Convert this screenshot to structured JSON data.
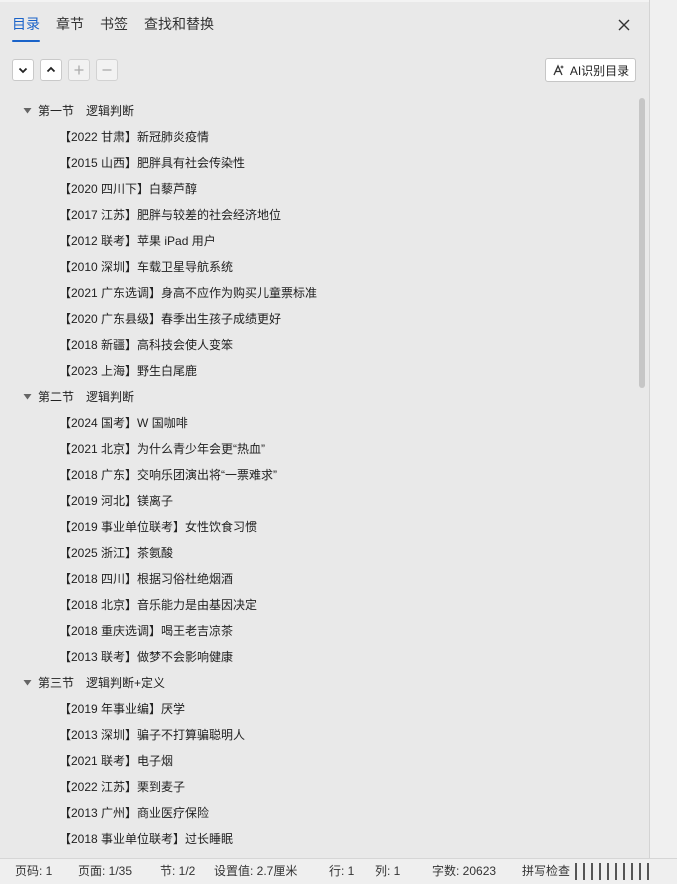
{
  "tabs": [
    "目录",
    "章节",
    "书签",
    "查找和替换"
  ],
  "active_tab": "目录",
  "toolbar": {
    "ai_button": "AI识别目录"
  },
  "toc": [
    {
      "title": "第一节　逻辑判断",
      "items": [
        "【2022 甘肃】新冠肺炎疫情",
        "【2015 山西】肥胖具有社会传染性",
        "【2020 四川下】白藜芦醇",
        "【2017 江苏】肥胖与较差的社会经济地位",
        "【2012 联考】苹果 iPad 用户",
        "【2010 深圳】车载卫星导航系统",
        "【2021 广东选调】身高不应作为购买儿童票标准",
        "【2020 广东县级】春季出生孩子成绩更好",
        "【2018 新疆】高科技会使人变笨",
        "【2023 上海】野生白尾鹿"
      ]
    },
    {
      "title": "第二节　逻辑判断",
      "items": [
        "【2024 国考】W 国咖啡",
        "【2021 北京】为什么青少年会更“热血”",
        "【2018 广东】交响乐团演出将“一票难求”",
        "【2019 河北】镁离子",
        "【2019 事业单位联考】女性饮食习惯",
        "【2025 浙江】茶氨酸",
        "【2018 四川】根据习俗杜绝烟酒",
        "【2018 北京】音乐能力是由基因决定",
        "【2018 重庆选调】喝王老吉凉茶",
        "【2013 联考】做梦不会影响健康"
      ]
    },
    {
      "title": "第三节　逻辑判断+定义",
      "items": [
        "【2019 年事业编】厌学",
        "【2013 深圳】骗子不打算骗聪明人",
        "【2021 联考】电子烟",
        "【2022 江苏】栗到麦子",
        "【2013 广州】商业医疗保险",
        "【2018 事业单位联考】过长睡眠"
      ]
    }
  ],
  "status": {
    "page_code": "页码: 1",
    "page": "页面: 1/35",
    "section": "节: 1/2",
    "setting": "设置值: 2.7厘米",
    "line": "行: 1",
    "col": "列: 1",
    "words": "字数: 20623",
    "spell": "拼写检查"
  },
  "colors": {
    "accent": "#1a63c9",
    "panel": "#e9e9e9"
  }
}
